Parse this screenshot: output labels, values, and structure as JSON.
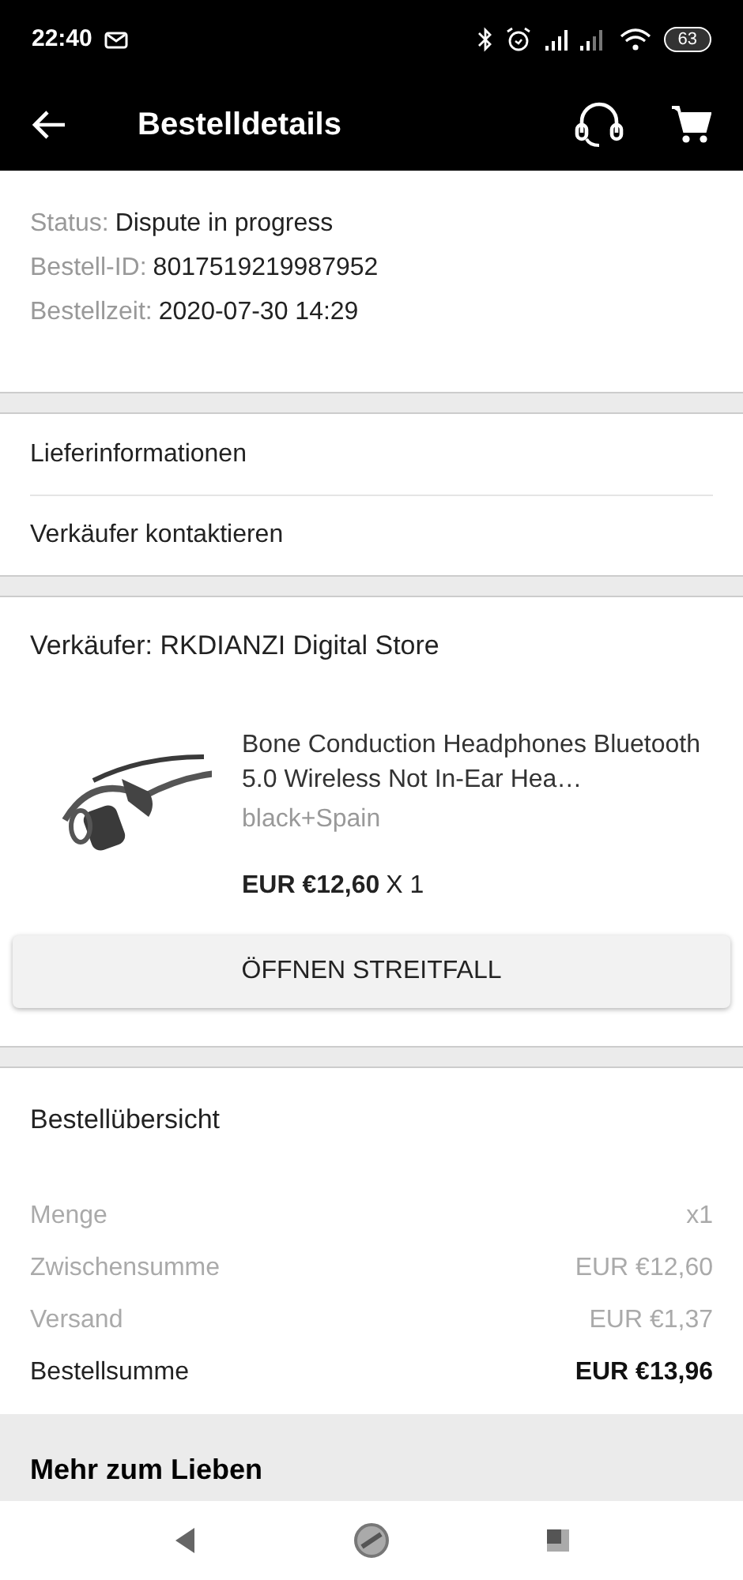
{
  "status_bar": {
    "time": "22:40",
    "battery": "63"
  },
  "app_bar": {
    "title": "Bestelldetails"
  },
  "order_info": [
    {
      "label": "Status:",
      "value": "Dispute in progress"
    },
    {
      "label": "Bestell-ID:",
      "value": "8017519219987952"
    },
    {
      "label": "Bestellzeit:",
      "value": "2020-07-30 14:29"
    }
  ],
  "links": [
    "Lieferinformationen",
    "Verkäufer kontaktieren"
  ],
  "seller": {
    "title": "Verkäufer: RKDIANZI Digital Store",
    "product": {
      "name": "Bone Conduction Headphones Bluetooth 5.0 Wireless Not In-Ear Hea…",
      "variant": "black+Spain",
      "price": "EUR €12,60",
      "quantity": "X 1"
    },
    "button": "ÖFFNEN STREITFALL"
  },
  "summary": {
    "title": "Bestellübersicht",
    "rows": [
      {
        "label": "Menge",
        "value": "x1",
        "total": false
      },
      {
        "label": "Zwischensumme",
        "value": "EUR €12,60",
        "total": false
      },
      {
        "label": "Versand",
        "value": "EUR €1,37",
        "total": false
      },
      {
        "label": "Bestellsumme",
        "value": "EUR €13,96",
        "total": true
      }
    ]
  },
  "more": {
    "title": "Mehr zum Lieben"
  }
}
